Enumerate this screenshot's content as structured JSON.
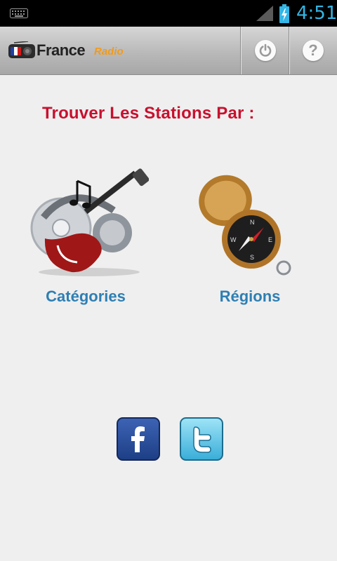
{
  "status_bar": {
    "time": "4:51",
    "icons": [
      "keyboard-icon",
      "signal-icon",
      "battery-charging-icon"
    ]
  },
  "action_bar": {
    "logo_main": "France",
    "logo_sub": "Radio",
    "actions": [
      "power-icon",
      "help-icon"
    ],
    "help_glyph": "?"
  },
  "main": {
    "heading": "Trouver Les Stations Par :",
    "tiles": [
      {
        "label": "Catégories",
        "icon": "guitar-music-icon"
      },
      {
        "label": "Régions",
        "icon": "compass-icon"
      }
    ]
  },
  "social": [
    "facebook-icon",
    "twitter-icon"
  ],
  "colors": {
    "heading": "#c8102e",
    "tile_label": "#2e7fb3",
    "status_accent": "#33b5e5",
    "logo_sub": "#f29a1a"
  }
}
